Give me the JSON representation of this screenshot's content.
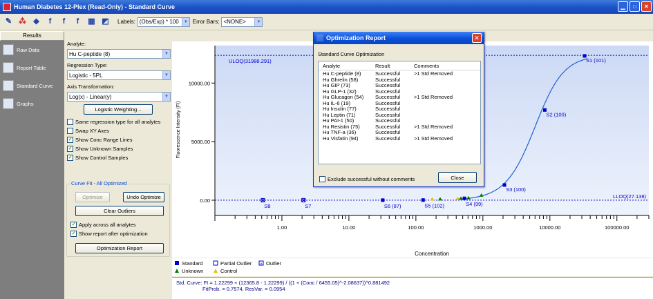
{
  "window": {
    "title": "Human Diabetes 12-Plex (Read-Only) - Standard Curve"
  },
  "toolbar": {
    "labels_label": "Labels:",
    "labels_value": "(Obs/Exp) * 100",
    "error_bars_label": "Error Bars:",
    "error_bars_value": "<NONE>"
  },
  "sidebar": {
    "header": "Results",
    "items": [
      {
        "label": "Raw Data",
        "icon": "raw-data-icon"
      },
      {
        "label": "Report Table",
        "icon": "report-table-icon"
      },
      {
        "label": "Standard Curve",
        "icon": "standard-curve-icon"
      },
      {
        "label": "Graphs",
        "icon": "graphs-icon"
      }
    ]
  },
  "panel": {
    "analyte_label": "Analyte:",
    "analyte_value": "Hu C-peptide (8)",
    "regression_label": "Regression Type:",
    "regression_value": "Logistic - 5PL",
    "axis_label": "Axis Transformation:",
    "axis_value": "Log(x) - Linear(y)",
    "logistic_weighting": "Logistic Weighting...",
    "checks": [
      {
        "label": "Same regression type for all analytes",
        "checked": false
      },
      {
        "label": "Swap XY Axes",
        "checked": false
      },
      {
        "label": "Show Conc Range Lines",
        "checked": true
      },
      {
        "label": "Show Unknown Samples",
        "checked": true
      },
      {
        "label": "Show Control Samples",
        "checked": true
      }
    ],
    "curve_fit_title": "Curve Fit - All Optimized",
    "optimize": "Optimize",
    "undo_optimize": "Undo Optimize",
    "clear_outliers": "Clear Outliers",
    "apply_all": "Apply across all analytes",
    "show_report": "Show report after optimization",
    "optimization_report": "Optimization Report"
  },
  "chart_data": {
    "type": "scatter",
    "xscale": "log",
    "xlim": [
      0.1,
      300000
    ],
    "ylim": [
      -1300,
      13200
    ],
    "xlabel": "Concentration",
    "ylabel": "Fluorescence Intensity (FI)",
    "xticks": [
      "1.00",
      "10.00",
      "100.00",
      "1000.00",
      "10000.00",
      "100000.00"
    ],
    "yticks": [
      "0.00",
      "5000.00",
      "10000.00"
    ],
    "uloq": {
      "label": "ULOQ(31988.291)",
      "value": 12365.8
    },
    "lloq": {
      "label": "LLOQ(27.138)",
      "value": 1.2
    },
    "standards": [
      {
        "label": "S8",
        "x": 0.52,
        "y": 3
      },
      {
        "label": "S7",
        "x": 2.1,
        "y": 4
      },
      {
        "label": "S6 (87)",
        "x": 32,
        "y": 6
      },
      {
        "label": "S5 (102)",
        "x": 128,
        "y": 15
      },
      {
        "label": "S4 (99)",
        "x": 530,
        "y": 160
      },
      {
        "label": "S3 (100)",
        "x": 2100,
        "y": 1300
      },
      {
        "label": "S2 (100)",
        "x": 8400,
        "y": 7700
      },
      {
        "label": "S1 (101)",
        "x": 33000,
        "y": 12320
      }
    ],
    "unknowns": [
      {
        "x": 230,
        "y": 30
      },
      {
        "x": 470,
        "y": 90
      },
      {
        "x": 610,
        "y": 130
      },
      {
        "x": 950,
        "y": 360
      }
    ],
    "controls": [
      {
        "x": 175,
        "y": 25
      },
      {
        "x": 420,
        "y": 75
      }
    ],
    "curve": {
      "a": 1.22299,
      "d": 12365.8,
      "c": 6455.05,
      "b": -2.08637,
      "g": 0.881492
    },
    "legend": [
      "Standard",
      "Partial Outlier",
      "Outlier",
      "Unknown",
      "Control"
    ],
    "colors": {
      "standard": "#0000cc",
      "unknown": "#008000",
      "control": "#e8c000",
      "band_top": "#ccd9f5",
      "band_bottom": "#eef3fc"
    }
  },
  "formula": {
    "line1": "Std. Curve: FI = 1.22299 + (12365.8 - 1.22299) / ((1 + (Conc / 6455.05)^-2.08637))^0.881492",
    "line2": "FitProb. = 0.7574, ResVar. = 0.0954"
  },
  "dialog": {
    "title": "Optimization Report",
    "subtitle": "Standard Curve Optimization",
    "columns": [
      "Analyte",
      "Result",
      "Comments"
    ],
    "rows": [
      {
        "analyte": "Hu C-peptide (8)",
        "result": "Successful",
        "comment": ">1 Std Removed"
      },
      {
        "analyte": "Hu Ghrelin (58)",
        "result": "Successful",
        "comment": ""
      },
      {
        "analyte": "Hu GIP (73)",
        "result": "Successful",
        "comment": ""
      },
      {
        "analyte": "Hu GLP-1 (32)",
        "result": "Successful",
        "comment": ""
      },
      {
        "analyte": "Hu Glucagon (54)",
        "result": "Successful",
        "comment": ">1 Std Removed"
      },
      {
        "analyte": "Hu IL-6 (19)",
        "result": "Successful",
        "comment": ""
      },
      {
        "analyte": "Hu Insulin (77)",
        "result": "Successful",
        "comment": ""
      },
      {
        "analyte": "Hu Leptin (71)",
        "result": "Successful",
        "comment": ""
      },
      {
        "analyte": "Hu PAI-1 (50)",
        "result": "Successful",
        "comment": ""
      },
      {
        "analyte": "Hu Resistin (75)",
        "result": "Successful",
        "comment": ">1 Std Removed"
      },
      {
        "analyte": "Hu TNF-a (36)",
        "result": "Successful",
        "comment": ""
      },
      {
        "analyte": "Hu Visfatin (94)",
        "result": "Successful",
        "comment": ">1 Std Removed"
      }
    ],
    "exclude_label": "Exclude successful without comments",
    "close": "Close"
  }
}
